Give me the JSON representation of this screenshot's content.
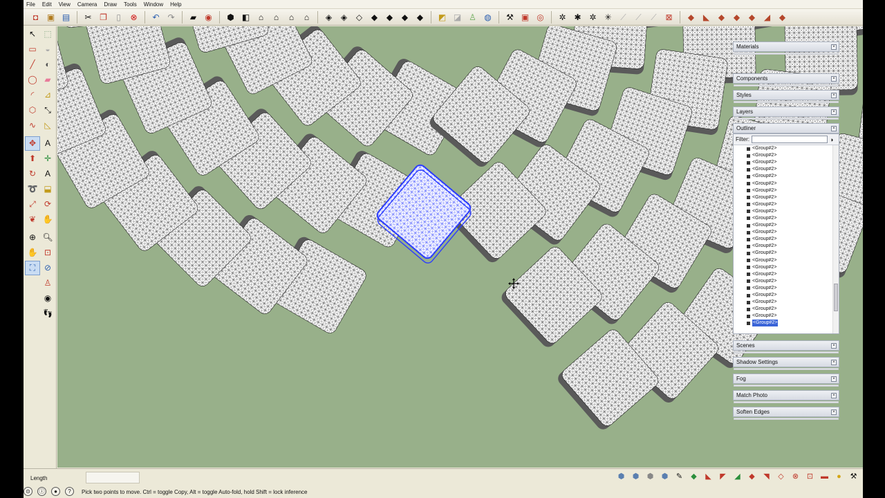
{
  "menu": [
    "File",
    "Edit",
    "View",
    "Camera",
    "Draw",
    "Tools",
    "Window",
    "Help"
  ],
  "toolbar_icons": [
    "new-icon",
    "open-icon",
    "save-icon",
    "cut-icon",
    "copy-icon",
    "paste-icon",
    "erase-icon",
    "undo-icon",
    "redo-icon",
    "print-icon",
    "model-info-icon",
    "iso-view-icon",
    "top-view-icon",
    "front-view-icon",
    "right-view-icon",
    "back-view-icon",
    "left-view-icon",
    "xray-icon",
    "back-edges-icon",
    "wireframe-icon",
    "hidden-line-icon",
    "shaded-icon",
    "textured-icon",
    "monochrome-icon",
    "section-plane-icon",
    "display-section-icon",
    "display-cuts-icon",
    "position-camera-icon",
    "walk-icon",
    "look-around-icon",
    "add-location-icon",
    "toggle-terrain-icon",
    "get-models-icon",
    "share-model-icon",
    "extension-warehouse-icon",
    "solid-union-icon",
    "solid-subtract-icon",
    "solid-trim-icon",
    "solid-intersect-icon",
    "solid-split-icon",
    "outer-shell-icon",
    "sandbox-smoove-icon",
    "sandbox-stamp-icon",
    "sandbox-drape-icon",
    "sandbox-detail-icon",
    "sandbox-flip-icon",
    "ruby-console-icon",
    "plugin-a-icon",
    "plugin-b-icon",
    "plugin-c-icon"
  ],
  "tray": {
    "materials": "Materials",
    "components": "Components",
    "styles": "Styles",
    "layers": "Layers",
    "outliner": "Outliner",
    "filter_label": "Filter:",
    "filter_value": "",
    "outliner_items": [
      "<Group#2>",
      "<Group#2>",
      "<Group#2>",
      "<Group#2>",
      "<Group#2>",
      "<Group#2>",
      "<Group#2>",
      "<Group#2>",
      "<Group#2>",
      "<Group#2>",
      "<Group#2>",
      "<Group#2>",
      "<Group#2>",
      "<Group#2>",
      "<Group#2>",
      "<Group#2>",
      "<Group#2>",
      "<Group#2>",
      "<Group#2>",
      "<Group#2>",
      "<Group#2>",
      "<Group#2>",
      "<Group#2>",
      "<Group#2>",
      "<Group#2>",
      "<Group#2>"
    ],
    "selected_index": 25,
    "scenes": "Scenes",
    "shadow_settings": "Shadow Settings",
    "fog": "Fog",
    "match_photo": "Match Photo",
    "soften_edges": "Soften Edges"
  },
  "status": {
    "measure_label": "Length",
    "measure_value": "",
    "hint": "Pick two points to move.  Ctrl = toggle Copy, Alt = toggle Auto-fold, hold Shift = lock inference"
  },
  "colors": {
    "ground": "#98b08a",
    "selection": "#2b3cff",
    "mesh": "#1a1a1a"
  }
}
